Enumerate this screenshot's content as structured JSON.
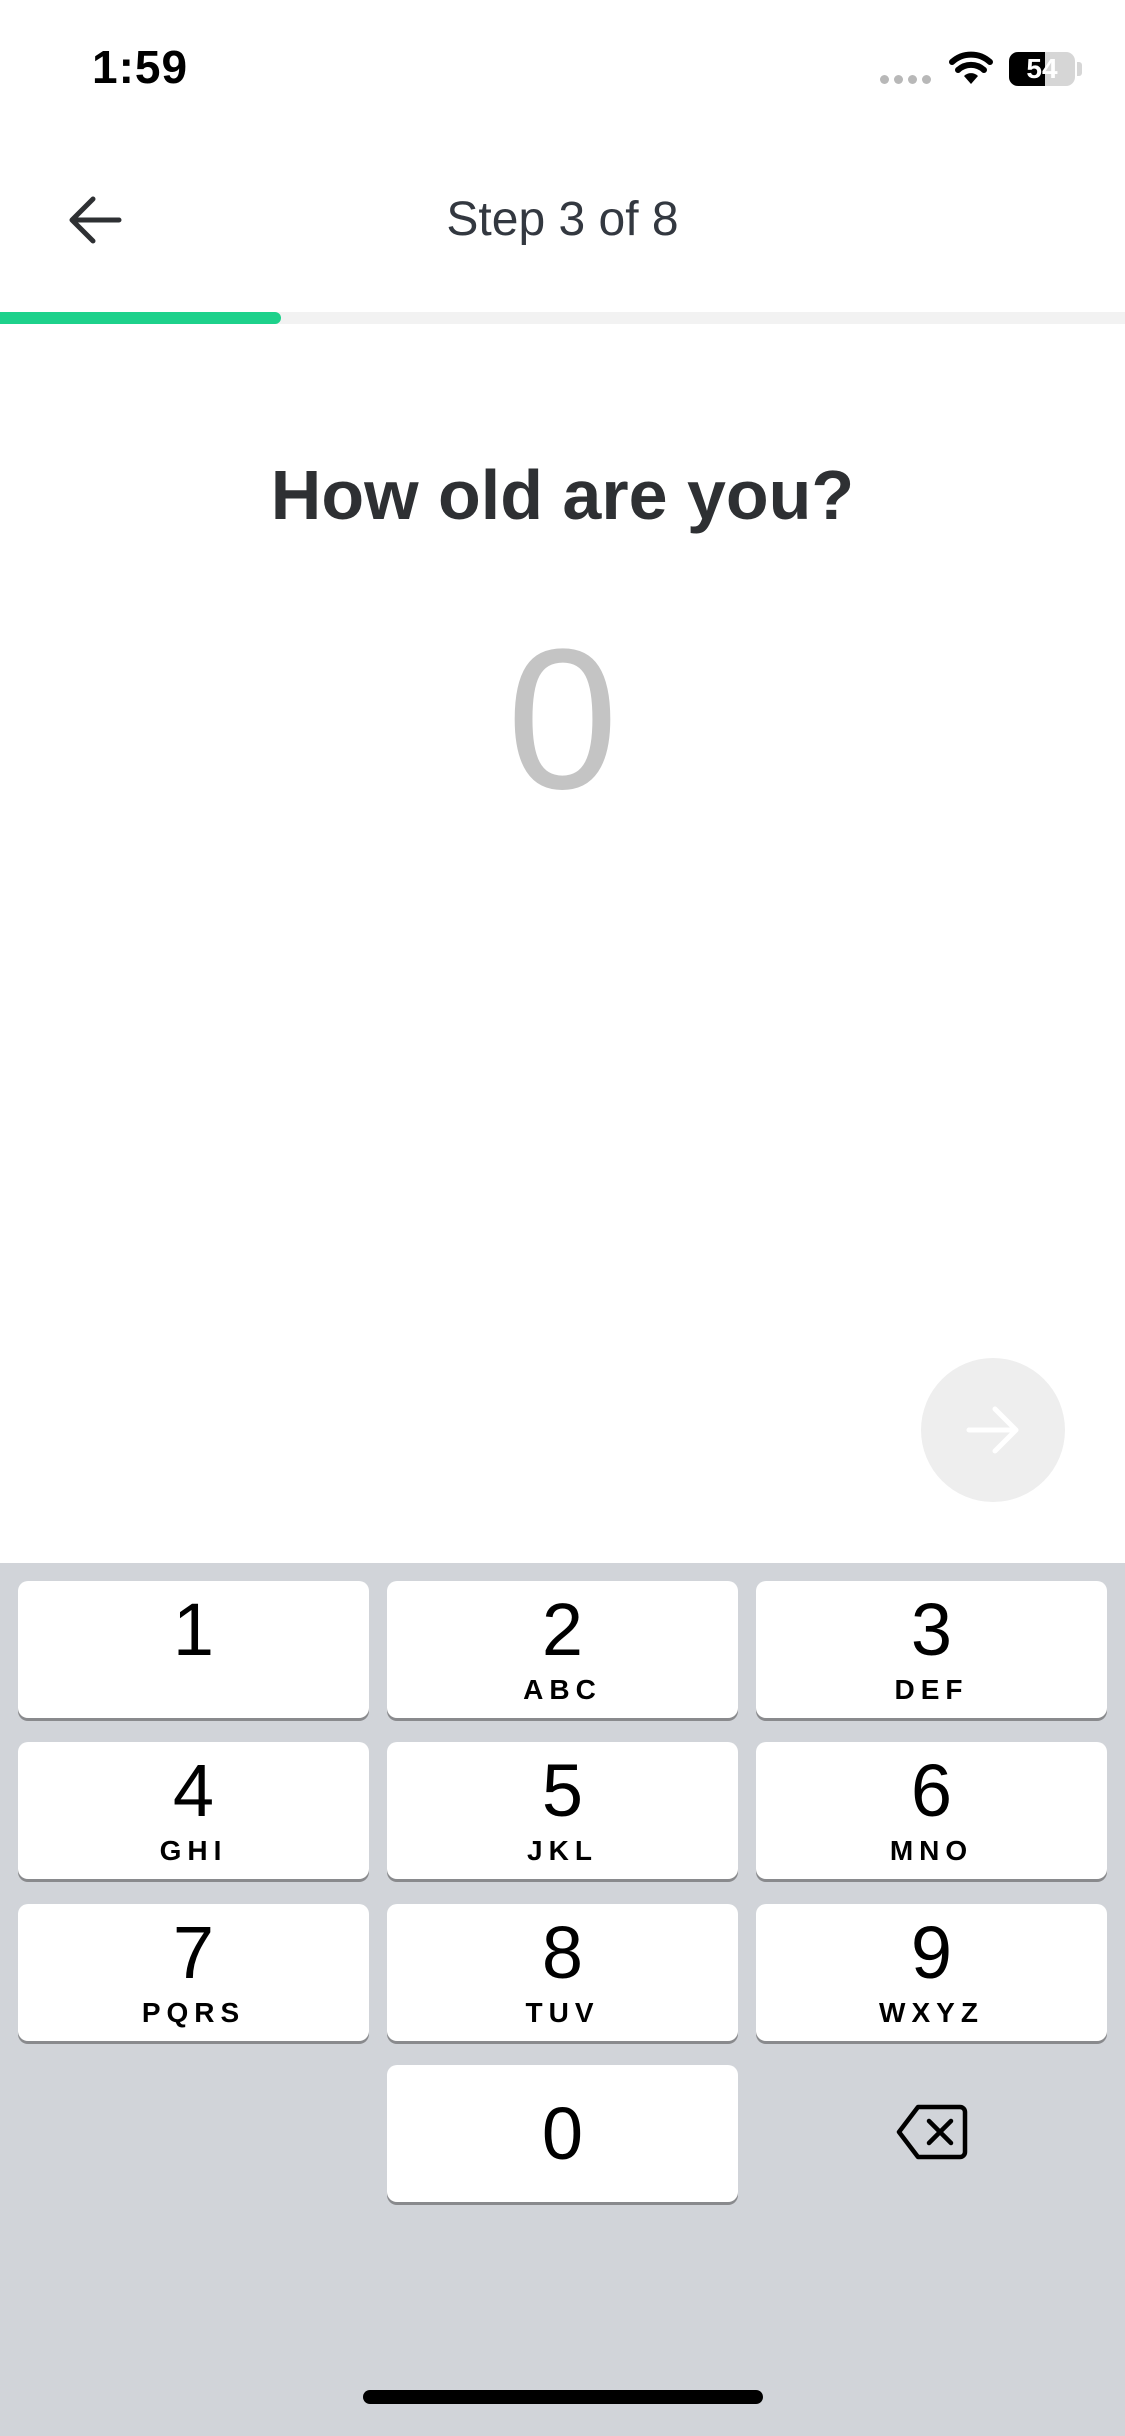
{
  "status_bar": {
    "time": "1:59",
    "battery_level": 54,
    "battery_label": "54",
    "icons": [
      "signal-dots-icon",
      "wifi-icon",
      "battery-icon"
    ]
  },
  "header": {
    "back_icon": "arrow-left-icon",
    "step_title": "Step 3 of 8"
  },
  "progress": {
    "current_step": 3,
    "total_steps": 8,
    "fraction": 0.25,
    "color": "#1dd18b"
  },
  "question": {
    "title": "How old are you?",
    "value": "0"
  },
  "next_button": {
    "icon": "arrow-right-icon",
    "enabled": false
  },
  "keypad": {
    "keys": [
      {
        "digit": "1",
        "letters": ""
      },
      {
        "digit": "2",
        "letters": "ABC"
      },
      {
        "digit": "3",
        "letters": "DEF"
      },
      {
        "digit": "4",
        "letters": "GHI"
      },
      {
        "digit": "5",
        "letters": "JKL"
      },
      {
        "digit": "6",
        "letters": "MNO"
      },
      {
        "digit": "7",
        "letters": "PQRS"
      },
      {
        "digit": "8",
        "letters": "TUV"
      },
      {
        "digit": "9",
        "letters": "WXYZ"
      }
    ],
    "zero": {
      "digit": "0"
    },
    "delete_icon": "backspace-icon"
  },
  "colors": {
    "accent": "#1dd18b",
    "keypad_bg": "#d1d4d9",
    "title_text": "#2e3033",
    "placeholder_value": "#c4c4c4"
  }
}
